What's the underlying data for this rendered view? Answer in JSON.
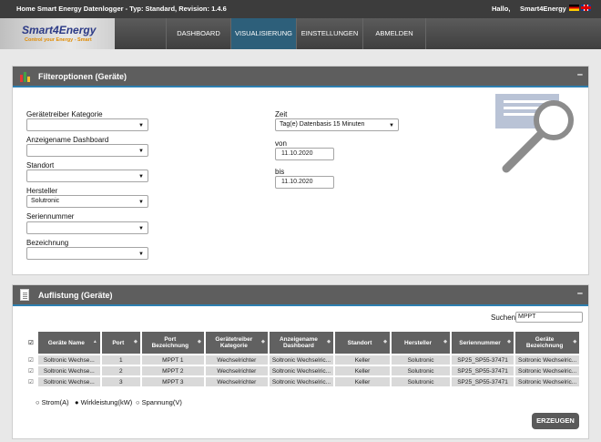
{
  "header": {
    "title": "Home Smart Energy Datenlogger - Typ: Standard, Revision: 1.4.6",
    "greeting": "Hallo,",
    "user": "Smart4Energy"
  },
  "logo": {
    "brand": "Smart4Energy",
    "tagline": "Control your Energy - Smart"
  },
  "nav": [
    {
      "label": "DASHBOARD"
    },
    {
      "label": "VISUALISIERUNG"
    },
    {
      "label": "EINSTELLUNGEN"
    },
    {
      "label": "ABMELDEN"
    }
  ],
  "filter": {
    "title": "Filteroptionen (Geräte)",
    "collapse": "–",
    "fields": [
      {
        "label": "Gerätetreiber Kategorie",
        "value": ""
      },
      {
        "label": "Anzeigename Dashboard",
        "value": ""
      },
      {
        "label": "Standort",
        "value": ""
      },
      {
        "label": "Hersteller",
        "value": "Solutronic"
      },
      {
        "label": "Seriennummer",
        "value": ""
      },
      {
        "label": "Bezeichnung",
        "value": ""
      }
    ],
    "zeit": {
      "label": "Zeit",
      "value": "Tag(e) Datenbasis 15 Minuten"
    },
    "von": {
      "label": "von",
      "value": "11.10.2020"
    },
    "bis": {
      "label": "bis",
      "value": "11.10.2020"
    }
  },
  "list": {
    "title": "Auflistung (Geräte)",
    "collapse": "–",
    "search_label": "Suchen",
    "search_value": "MPPT",
    "columns": [
      "Geräte Name",
      "Port",
      "Port Bezeichnung",
      "Gerätetreiber Kategorie",
      "Anzeigename Dashboard",
      "Standort",
      "Hersteller",
      "Seriennummer",
      "Geräte Bezeichnung"
    ],
    "rows": [
      [
        "Soltronic Wechse...",
        "1",
        "MPPT 1",
        "Wechselrichter",
        "Soltronic Wechselric...",
        "Keller",
        "Solutronic",
        "SP25_SP55-37471",
        "Soltronic Wechselric..."
      ],
      [
        "Soltronic Wechse...",
        "2",
        "MPPT 2",
        "Wechselrichter",
        "Soltronic Wechselric...",
        "Keller",
        "Solutronic",
        "SP25_SP55-37471",
        "Soltronic Wechselric..."
      ],
      [
        "Soltronic Wechse...",
        "3",
        "MPPT 3",
        "Wechselrichter",
        "Soltronic Wechselric...",
        "Keller",
        "Solutronic",
        "SP25_SP55-37471",
        "Soltronic Wechselric..."
      ]
    ],
    "radios": [
      {
        "label": "Strom(A)",
        "selected": false
      },
      {
        "label": "Wirkleistung(kW)",
        "selected": true
      },
      {
        "label": "Spannung(V)",
        "selected": false
      }
    ],
    "create_button": "ERZEUGEN"
  }
}
